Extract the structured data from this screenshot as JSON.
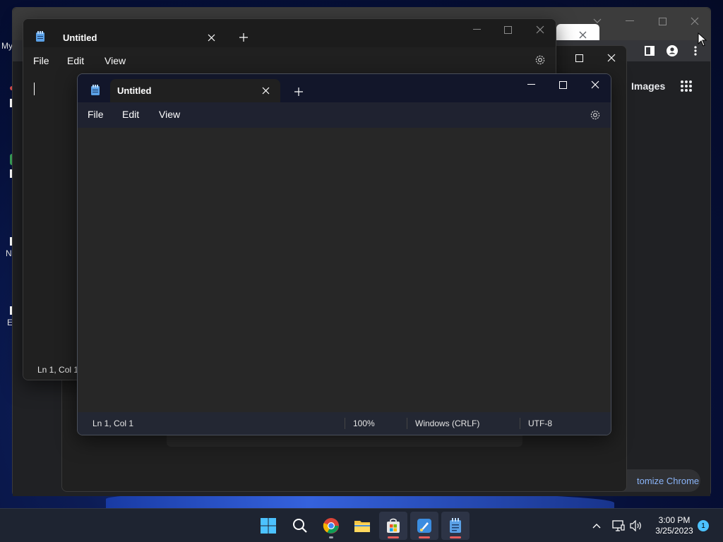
{
  "desktop": {
    "labels": [
      "My",
      "N",
      "E"
    ]
  },
  "chrome": {
    "images_link": "Images",
    "customize_button": "tomize Chrome",
    "icons": [
      "side-panel-icon",
      "profile-icon",
      "more-vert-icon",
      "apps-grid-icon"
    ]
  },
  "notepad_back": {
    "tab_title": "Untitled",
    "menu": {
      "file": "File",
      "edit": "Edit",
      "view": "View"
    },
    "status": {
      "position": "Ln 1, Col 1"
    }
  },
  "notepad_front": {
    "tab_title": "Untitled",
    "menu": {
      "file": "File",
      "edit": "Edit",
      "view": "View"
    },
    "status": {
      "position": "Ln 1, Col 1",
      "zoom": "100%",
      "line_ending": "Windows (CRLF)",
      "encoding": "UTF-8"
    }
  },
  "taskbar": {
    "apps": [
      "start-button",
      "search-icon",
      "chrome-icon",
      "file-explorer-icon",
      "microsoft-store-icon",
      "paint-icon",
      "notepad-icon"
    ],
    "clock": {
      "time": "3:00 PM",
      "date": "3/25/2023"
    },
    "notification_count": "1"
  },
  "colors": {
    "accent_blue": "#4cc2ff",
    "notepad_icon": "#5aa0e6",
    "link_blue": "#8ab4f8"
  }
}
